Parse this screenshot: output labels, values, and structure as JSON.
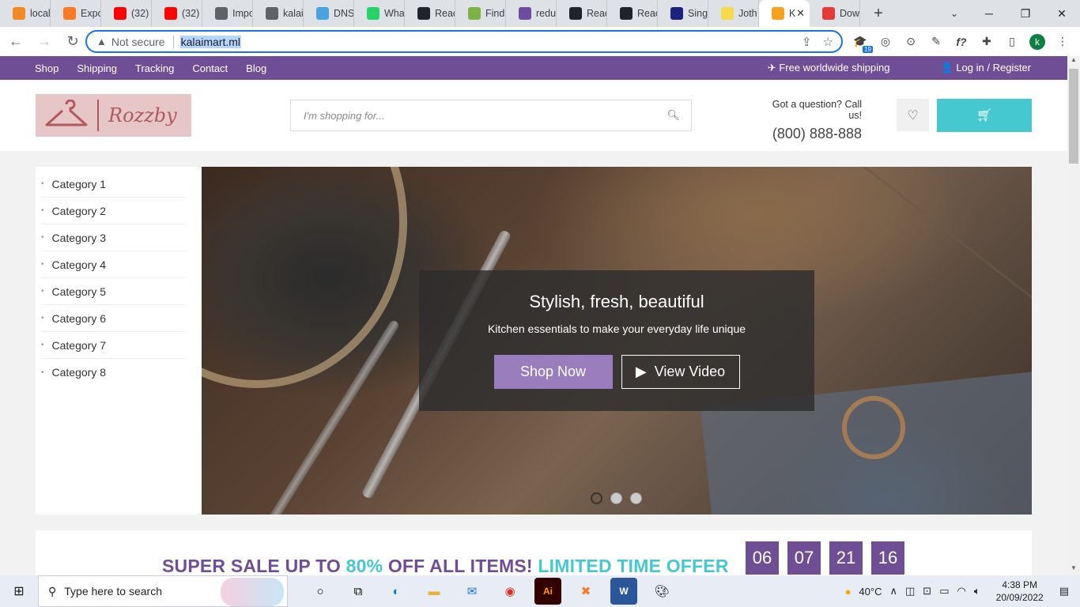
{
  "browser": {
    "tabs": [
      {
        "label": "local",
        "icon": "pma-icon",
        "color": "#f08a24"
      },
      {
        "label": "Expo",
        "icon": "xampp-icon",
        "color": "#fb7a24"
      },
      {
        "label": "(32)",
        "icon": "youtube-icon",
        "color": "#ff0000"
      },
      {
        "label": "(32)",
        "icon": "youtube-icon",
        "color": "#ff0000"
      },
      {
        "label": "Impo",
        "icon": "globe-icon",
        "color": "#5f6368"
      },
      {
        "label": "kalai",
        "icon": "globe-icon",
        "color": "#5f6368"
      },
      {
        "label": "DNS",
        "icon": "dns-icon",
        "color": "#4aa3df"
      },
      {
        "label": "Wha",
        "icon": "whatsapp-icon",
        "color": "#25d366"
      },
      {
        "label": "Reac",
        "icon": "react-icon",
        "color": "#20232a"
      },
      {
        "label": "Find",
        "icon": "find-icon",
        "color": "#7cb342"
      },
      {
        "label": "redu",
        "icon": "hackernoon-icon",
        "color": "#6e4c9e"
      },
      {
        "label": "Reac",
        "icon": "react-icon",
        "color": "#20232a"
      },
      {
        "label": "Reac",
        "icon": "react-icon",
        "color": "#20232a"
      },
      {
        "label": "Sing",
        "icon": "bank-icon",
        "color": "#1a237e"
      },
      {
        "label": "Joth",
        "icon": "bolt-icon",
        "color": "#f7d94c"
      },
      {
        "label": "K",
        "icon": "cart-icon",
        "color": "#f6a21d",
        "active": true
      },
      {
        "label": "Dow",
        "icon": "heart-icon",
        "color": "#e53935"
      }
    ],
    "omnibox": {
      "security": "Not secure",
      "url": "kalaimart.ml"
    },
    "profile_initial": "k",
    "ext_badge": "19"
  },
  "site": {
    "topnav": [
      "Shop",
      "Shipping",
      "Tracking",
      "Contact",
      "Blog"
    ],
    "free_shipping": "Free worldwide shipping",
    "login": "Log in / Register",
    "logo_name": "Rozzby",
    "search_placeholder": "I'm shopping for...",
    "call_question": "Got a question? Call us!",
    "phone": "(800) 888-888",
    "categories": [
      "Category 1",
      "Category 2",
      "Category 3",
      "Category 4",
      "Category 5",
      "Category 6",
      "Category 7",
      "Category 8"
    ],
    "hero": {
      "title": "Stylish, fresh, beautiful",
      "subtitle": "Kitchen essentials to make your everyday life unique",
      "shop_now": "Shop Now",
      "view_video": "View Video",
      "active_slide": 1,
      "slide_count": 3
    },
    "sale": {
      "part1": "SUPER SALE UP TO ",
      "percent": "80%",
      "part2": " OFF ALL ITEMS! ",
      "limited": "LIMITED TIME OFFER",
      "timer": [
        "06",
        "07",
        "21",
        "16"
      ]
    },
    "colors": {
      "brand_purple": "#6f4e95",
      "accent_teal": "#45c8cf",
      "button_purple": "#9a7dbc"
    }
  },
  "taskbar": {
    "search_placeholder": "Type here to search",
    "weather": "40°C",
    "time": "4:38 PM",
    "date": "20/09/2022"
  }
}
